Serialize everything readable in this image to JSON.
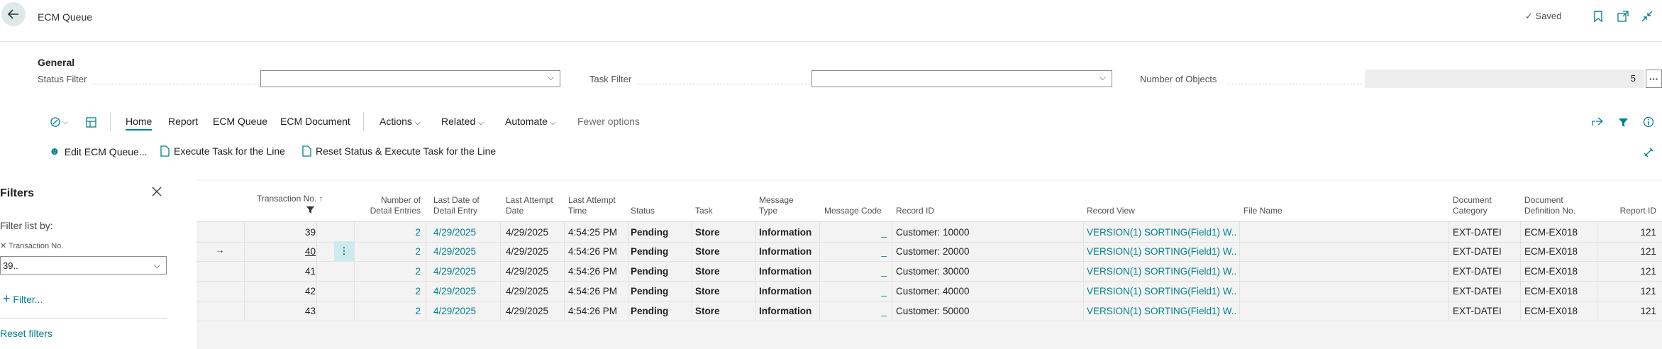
{
  "header": {
    "title": "ECM Queue",
    "saved": "Saved",
    "saved_icon": "check-icon"
  },
  "general": {
    "heading": "General",
    "status_filter_label": "Status Filter",
    "status_filter_value": "",
    "task_filter_label": "Task Filter",
    "task_filter_value": "",
    "num_objects_label": "Number of Objects",
    "num_objects_value": "5",
    "more_label": "···"
  },
  "menu": {
    "home": "Home",
    "report": "Report",
    "ecm_queue": "ECM Queue",
    "ecm_document": "ECM Document",
    "actions": "Actions",
    "related": "Related",
    "automate": "Automate",
    "fewer": "Fewer options"
  },
  "actions": {
    "edit": "Edit ECM Queue...",
    "execute": "Execute Task for the Line",
    "reset_execute": "Reset Status & Execute Task for the Line"
  },
  "filters": {
    "title": "Filters",
    "list_by": "Filter list by:",
    "field": "Transaction No.",
    "value": "39..",
    "add": "Filter...",
    "reset": "Reset filters"
  },
  "table": {
    "headers": {
      "transaction_no": "Transaction No.",
      "detail_entries_1": "Number of",
      "detail_entries_2": "Detail Entries",
      "last_date_1": "Last Date of",
      "last_date_2": "Detail Entry",
      "attempt_date_1": "Last Attempt",
      "attempt_date_2": "Date",
      "attempt_time_1": "Last Attempt",
      "attempt_time_2": "Time",
      "status": "Status",
      "task": "Task",
      "msg_type_1": "Message",
      "msg_type_2": "Type",
      "msg_code": "Message Code",
      "record_id": "Record ID",
      "record_view": "Record View",
      "file_name": "File Name",
      "doc_cat_1": "Document",
      "doc_cat_2": "Category",
      "doc_def_1": "Document",
      "doc_def_2": "Definition No.",
      "report_id": "Report ID"
    },
    "rows": [
      {
        "tx": "39",
        "entries": "2",
        "last_date": "4/29/2025",
        "att_date": "4/29/2025",
        "att_time": "4:54:25 PM",
        "status": "Pending",
        "task": "Store",
        "msg_type": "Information",
        "msg_code": "_",
        "record_id": "Customer: 10000",
        "record_view": "VERSION(1) SORTING(Field1) W...",
        "file_name": "",
        "doc_cat": "EXT-DATEI",
        "doc_def": "ECM-EX018",
        "report_id": "121"
      },
      {
        "tx": "40",
        "entries": "2",
        "last_date": "4/29/2025",
        "att_date": "4/29/2025",
        "att_time": "4:54:26 PM",
        "status": "Pending",
        "task": "Store",
        "msg_type": "Information",
        "msg_code": "_",
        "record_id": "Customer: 20000",
        "record_view": "VERSION(1) SORTING(Field1) W...",
        "file_name": "",
        "doc_cat": "EXT-DATEI",
        "doc_def": "ECM-EX018",
        "report_id": "121"
      },
      {
        "tx": "41",
        "entries": "2",
        "last_date": "4/29/2025",
        "att_date": "4/29/2025",
        "att_time": "4:54:26 PM",
        "status": "Pending",
        "task": "Store",
        "msg_type": "Information",
        "msg_code": "_",
        "record_id": "Customer: 30000",
        "record_view": "VERSION(1) SORTING(Field1) W...",
        "file_name": "",
        "doc_cat": "EXT-DATEI",
        "doc_def": "ECM-EX018",
        "report_id": "121"
      },
      {
        "tx": "42",
        "entries": "2",
        "last_date": "4/29/2025",
        "att_date": "4/29/2025",
        "att_time": "4:54:26 PM",
        "status": "Pending",
        "task": "Store",
        "msg_type": "Information",
        "msg_code": "_",
        "record_id": "Customer: 40000",
        "record_view": "VERSION(1) SORTING(Field1) W...",
        "file_name": "",
        "doc_cat": "EXT-DATEI",
        "doc_def": "ECM-EX018",
        "report_id": "121"
      },
      {
        "tx": "43",
        "entries": "2",
        "last_date": "4/29/2025",
        "att_date": "4/29/2025",
        "att_time": "4:54:26 PM",
        "status": "Pending",
        "task": "Store",
        "msg_type": "Information",
        "msg_code": "_",
        "record_id": "Customer: 50000",
        "record_view": "VERSION(1) SORTING(Field1) W...",
        "file_name": "",
        "doc_cat": "EXT-DATEI",
        "doc_def": "ECM-EX018",
        "report_id": "121"
      }
    ]
  },
  "colors": {
    "accent": "#00828a"
  }
}
